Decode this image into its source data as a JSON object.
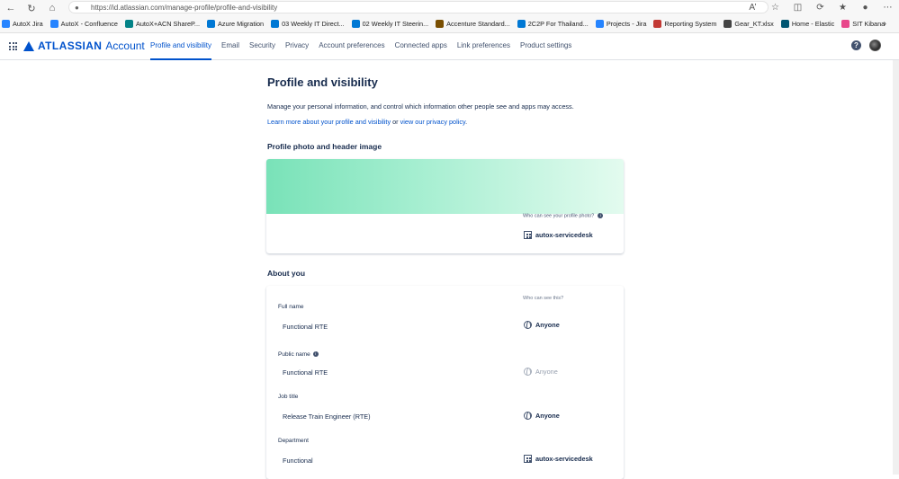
{
  "browser": {
    "url": "https://id.atlassian.com/manage-profile/profile-and-visibility",
    "bookmarks": [
      {
        "label": "AutoX Jira",
        "color": "#2684ff"
      },
      {
        "label": "AutoX - Confluence",
        "color": "#2684ff"
      },
      {
        "label": "AutoX+ACN ShareP...",
        "color": "#038387"
      },
      {
        "label": "Azure Migration",
        "color": "#0078d4"
      },
      {
        "label": "03 Weekly IT Direct...",
        "color": "#0078d4"
      },
      {
        "label": "02 Weekly IT Steerin...",
        "color": "#0078d4"
      },
      {
        "label": "Accenture Standard...",
        "color": "#7a4f01"
      },
      {
        "label": "2C2P For Thailand...",
        "color": "#0078d4"
      },
      {
        "label": "Projects - Jira",
        "color": "#2684ff"
      },
      {
        "label": "Reporting System",
        "color": "#c23934"
      },
      {
        "label": "Gear_KT.xlsx",
        "color": "#444444"
      },
      {
        "label": "Home - Elastic",
        "color": "#005571"
      },
      {
        "label": "SIT Kibana",
        "color": "#e8478b"
      }
    ]
  },
  "header": {
    "brand": "ATLASSIAN",
    "product": "Account",
    "tabs": [
      {
        "label": "Profile and visibility",
        "active": true
      },
      {
        "label": "Email"
      },
      {
        "label": "Security"
      },
      {
        "label": "Privacy"
      },
      {
        "label": "Account preferences"
      },
      {
        "label": "Connected apps"
      },
      {
        "label": "Link preferences"
      },
      {
        "label": "Product settings"
      }
    ],
    "help_icon": "?"
  },
  "page": {
    "title": "Profile and visibility",
    "intro": "Manage your personal information, and control which information other people see and apps may access.",
    "link_profile": "Learn more about your profile and visibility",
    "link_or": "or",
    "link_privacy": "view our privacy policy",
    "link_end": "."
  },
  "photo_section": {
    "heading": "Profile photo and header image",
    "who_can_see": "Who can see your profile photo?",
    "visibility": "autox-servicedesk"
  },
  "about": {
    "heading": "About you",
    "who_can_see": "Who can see this?",
    "fields": [
      {
        "label": "Full name",
        "value": "Functional RTE",
        "visibility": "Anyone"
      },
      {
        "label": "Public name",
        "value": "Functional RTE",
        "visibility": "Anyone"
      },
      {
        "label": "Job title",
        "value": "Release Train Engineer (RTE)",
        "visibility": "Anyone"
      },
      {
        "label": "Department",
        "value": "Functional",
        "visibility": "autox-servicedesk"
      }
    ]
  }
}
